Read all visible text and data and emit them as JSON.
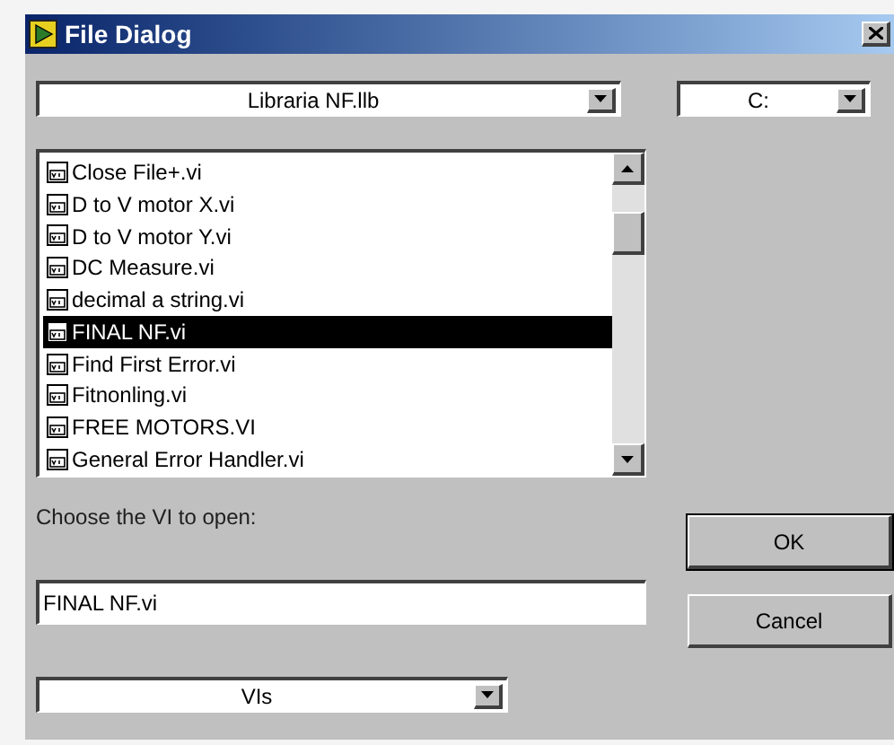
{
  "window": {
    "title": "File Dialog"
  },
  "library_dropdown": {
    "value": "Libraria NF.llb"
  },
  "drive_dropdown": {
    "value": "C:"
  },
  "file_list": [
    {
      "name": "Close File+.vi",
      "selected": false
    },
    {
      "name": "D to V motor X.vi",
      "selected": false
    },
    {
      "name": "D to V motor Y.vi",
      "selected": false
    },
    {
      "name": "DC Measure.vi",
      "selected": false
    },
    {
      "name": "decimal a string.vi",
      "selected": false
    },
    {
      "name": "FINAL NF.vi",
      "selected": true
    },
    {
      "name": "Find First Error.vi",
      "selected": false
    },
    {
      "name": "Fitnonling.vi",
      "selected": false
    },
    {
      "name": "FREE MOTORS.VI",
      "selected": false
    },
    {
      "name": "General Error Handler.vi",
      "selected": false
    }
  ],
  "prompt": "Choose the VI to open:",
  "filename_field": {
    "value": "FINAL NF.vi"
  },
  "buttons": [
    "OK",
    "Cancel"
  ],
  "type_dropdown": {
    "value": "VIs"
  }
}
